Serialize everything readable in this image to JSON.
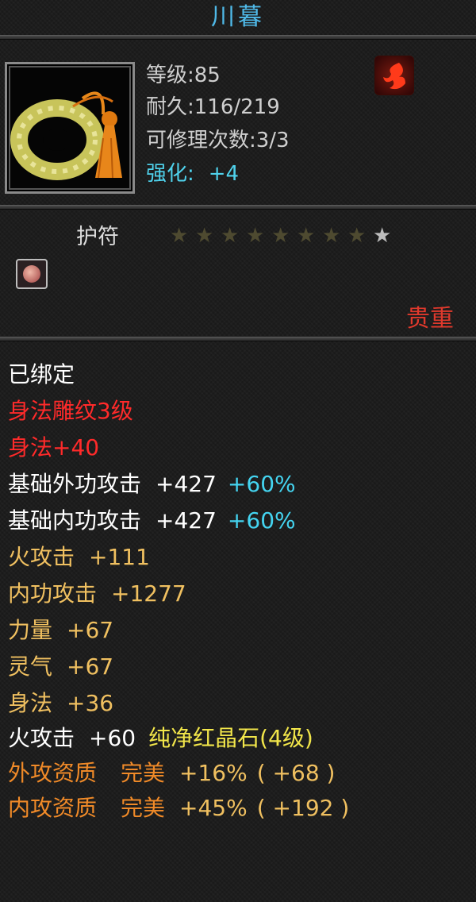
{
  "header": {
    "title": "川暮"
  },
  "item": {
    "level": "等级:85",
    "durability": "耐久:116/219",
    "repair_count": "可修理次数:3/3",
    "enhance_label": "强化:",
    "enhance_value": "+4"
  },
  "category": {
    "type_label": "护符",
    "stars_total": 9,
    "stars_lit": 1,
    "rarity": "贵重"
  },
  "attributes": {
    "bound": "已绑定",
    "carving": "身法雕纹3级",
    "agility_bonus": "身法+40",
    "ext_attack": {
      "label": "基础外功攻击",
      "value": "+427",
      "percent": "+60%"
    },
    "int_attack": {
      "label": "基础内功攻击",
      "value": "+427",
      "percent": "+60%"
    },
    "fire_attack": {
      "label": "火攻击",
      "value": "+111"
    },
    "inner_attack": {
      "label": "内功攻击",
      "value": "+1277"
    },
    "strength": {
      "label": "力量",
      "value": "+67"
    },
    "spirit": {
      "label": "灵气",
      "value": "+67"
    },
    "agility": {
      "label": "身法",
      "value": "+36"
    },
    "gem": {
      "label": "火攻击",
      "value": "+60",
      "gem_name": "纯净红晶石(4级)"
    },
    "ext_quality": {
      "label": "外攻资质",
      "grade": "完美",
      "percent": "+16%",
      "bonus": "( +68 )"
    },
    "int_quality": {
      "label": "内攻资质",
      "grade": "完美",
      "percent": "+45%",
      "bonus": "( +192 )"
    }
  },
  "icons": {
    "item_image": "jade-ring-amulet-icon",
    "element_badge": "fire-element-icon",
    "slot_gem": "pink-gem-icon"
  }
}
